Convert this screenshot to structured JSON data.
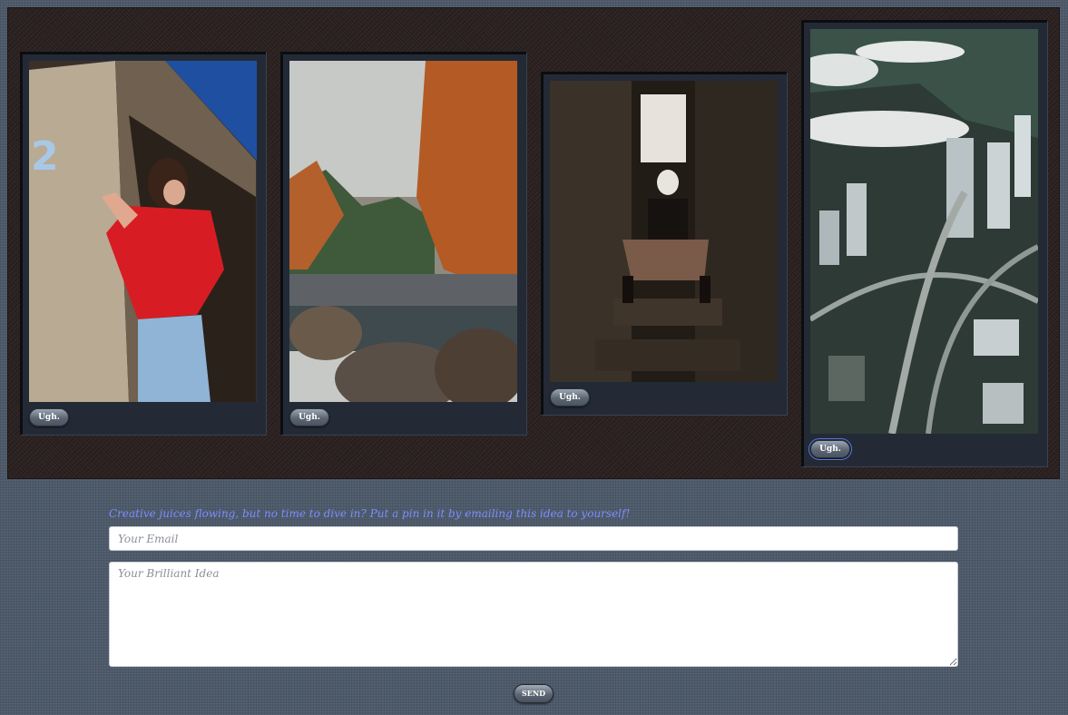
{
  "gallery": {
    "cards": [
      {
        "photo_subject": "woman-red-top-against-concrete-building",
        "action_label": "Ugh."
      },
      {
        "photo_subject": "autumn-river-with-rocks-and-fog",
        "action_label": "Ugh."
      },
      {
        "photo_subject": "person-with-skull-makeup-on-stairs",
        "action_label": "Ugh."
      },
      {
        "photo_subject": "aerial-city-highways-under-clouds",
        "action_label": "Ugh."
      }
    ]
  },
  "idea_form": {
    "prompt": "Creative juices flowing, but no time to dive in? Put a pin in it by emailing this idea to yourself!",
    "email_placeholder": "Your Email",
    "email_value": "",
    "idea_placeholder": "Your Brilliant Idea",
    "idea_value": "",
    "send_label": "SEND"
  },
  "colors": {
    "accent_text": "#7d8cff",
    "page_background": "#4d5a6a",
    "board_background": "#2b2120",
    "card_background": "#232a36"
  }
}
